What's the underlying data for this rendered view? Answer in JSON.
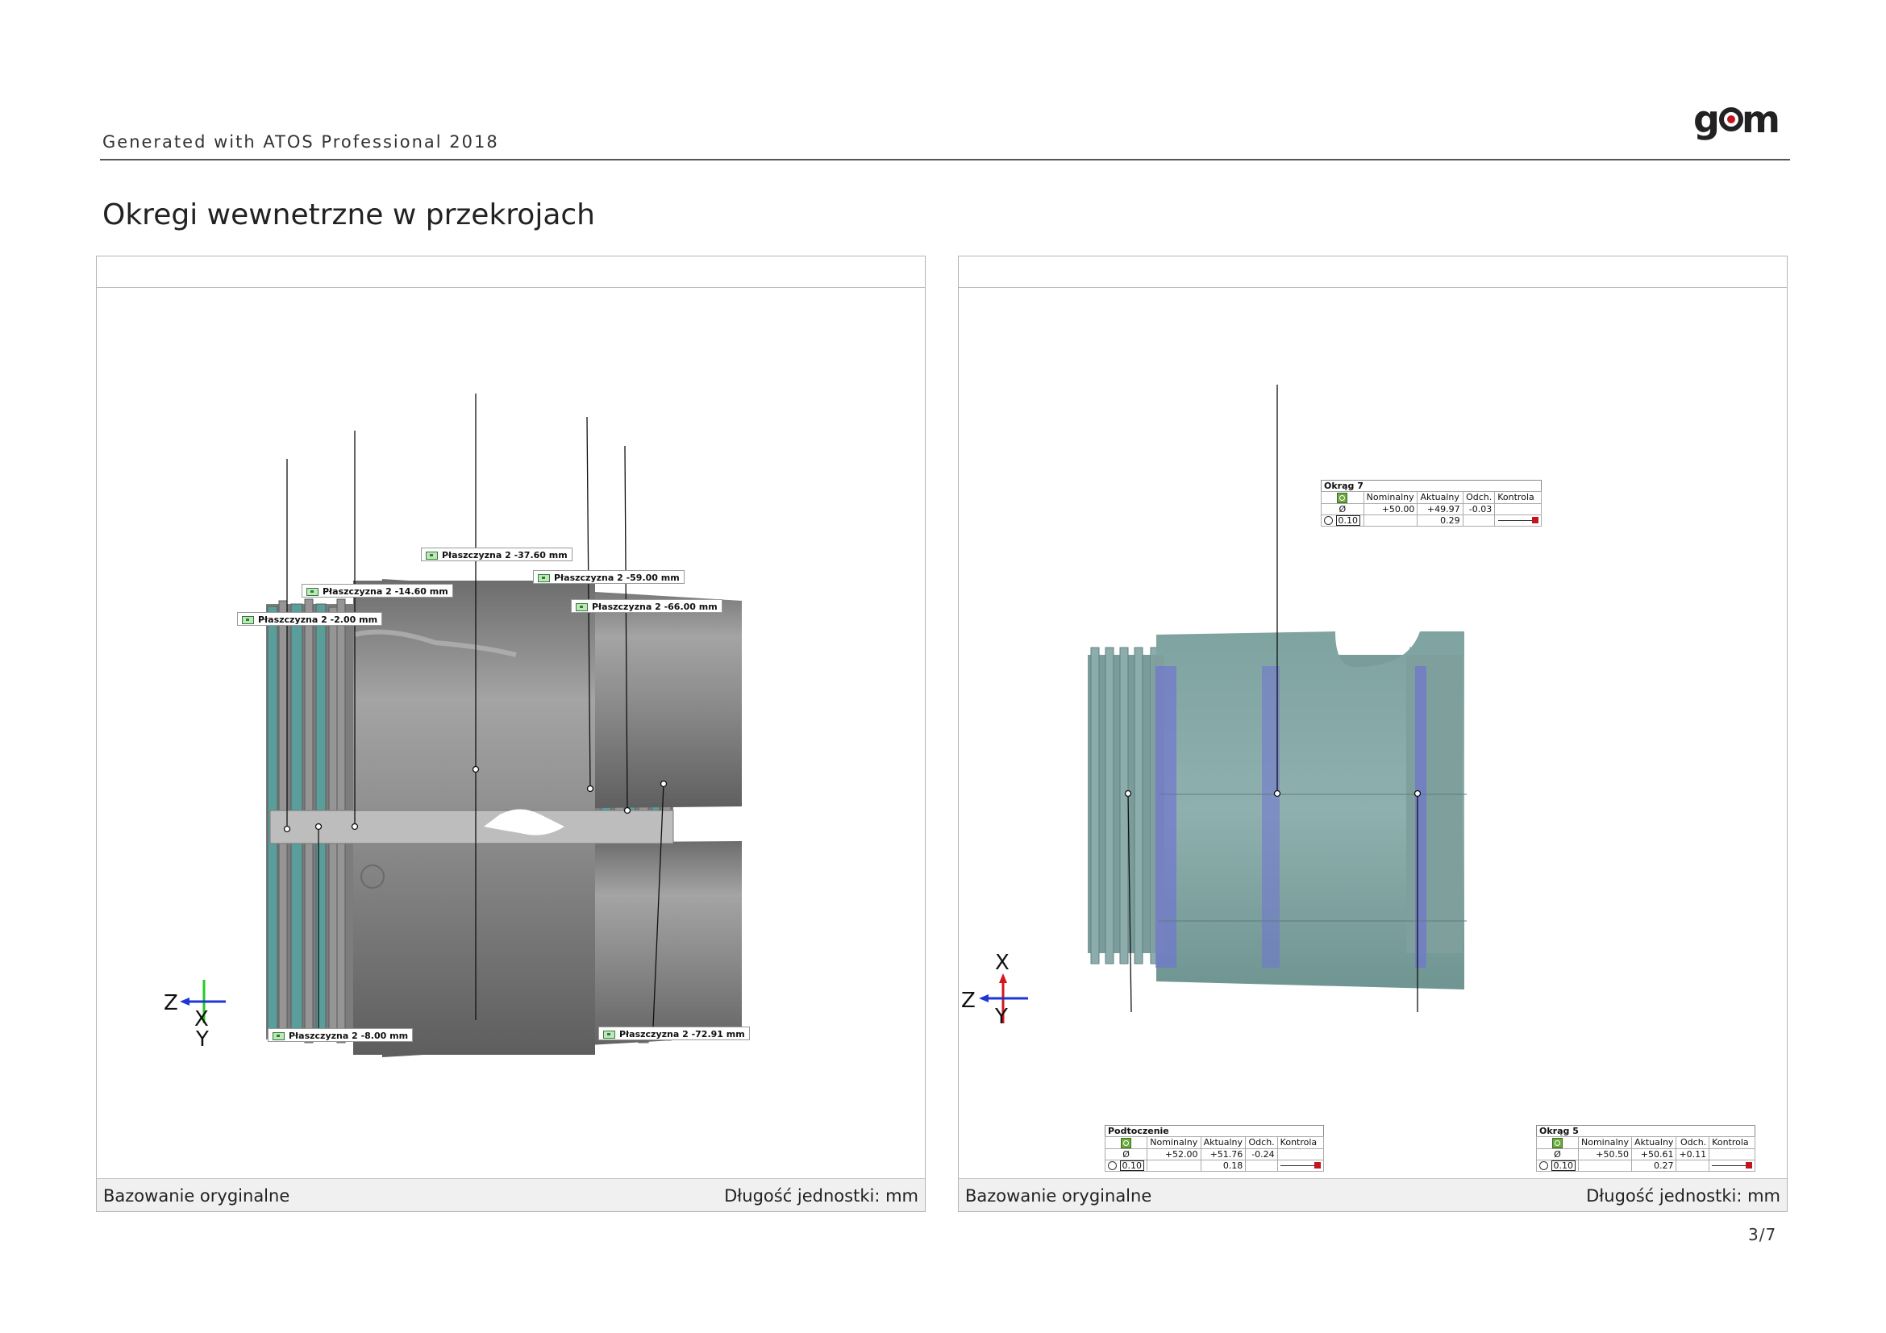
{
  "header": {
    "generator": "Generated with ATOS Professional 2018",
    "logo": "gom"
  },
  "title": "Okregi wewnetrzne w przekrojach",
  "left_panel": {
    "footer_left": "Bazowanie oryginalne",
    "footer_right": "Długość jednostki: mm",
    "axes": {
      "horizontal": "Z",
      "vertical_upper": "X",
      "vertical_lower": "Y"
    },
    "plane_labels": [
      "Płaszczyzna 2 -37.60 mm",
      "Płaszczyzna 2 -59.00 mm",
      "Płaszczyzna 2 -14.60 mm",
      "Płaszczyzna 2 -66.00 mm",
      "Płaszczyzna 2 -2.00 mm",
      "Płaszczyzna 2 -8.00 mm",
      "Płaszczyzna 2 -72.91 mm"
    ]
  },
  "right_panel": {
    "footer_left": "Bazowanie oryginalne",
    "footer_right": "Długość jednostki: mm",
    "axes": {
      "horizontal": "Z",
      "vertical_upper": "X",
      "vertical_lower": "Y"
    },
    "columns": [
      "Nominalny",
      "Aktualny",
      "Odch.",
      "Kontrola"
    ],
    "diameter_symbol": "Ø",
    "tables": [
      {
        "title": "Okrąg 7",
        "nominal": "+50.00",
        "actual": "+49.97",
        "dev": "-0.03",
        "tol": "0.10",
        "form": "0.29"
      },
      {
        "title": "Podtoczenie",
        "nominal": "+52.00",
        "actual": "+51.76",
        "dev": "-0.24",
        "tol": "0.10",
        "form": "0.18"
      },
      {
        "title": "Okrąg 5",
        "nominal": "+50.50",
        "actual": "+50.61",
        "dev": "+0.11",
        "tol": "0.10",
        "form": "0.27"
      }
    ]
  },
  "page_number": "3/7",
  "colors": {
    "teal": "#5a9e9b",
    "band": "#6f72d4",
    "metal": "#8a8a8a",
    "tol_marker": "#c0161c"
  }
}
